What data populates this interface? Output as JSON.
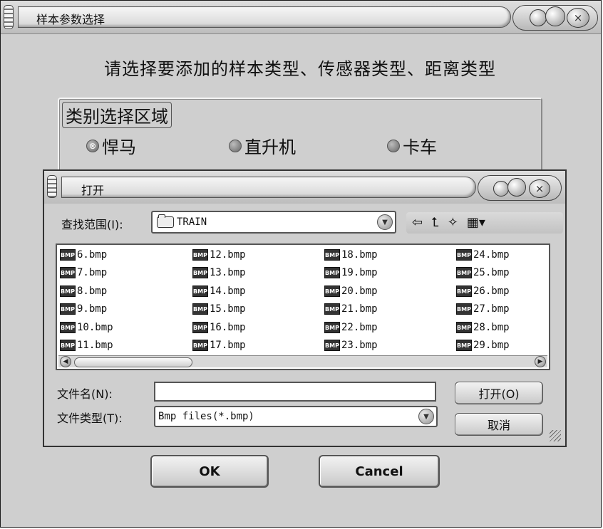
{
  "main_window": {
    "title": "样本参数选择",
    "prompt": "请选择要添加的样本类型、传感器类型、距离类型",
    "group_title": "类别选择区域",
    "radios": [
      {
        "label": "悍马",
        "selected": true
      },
      {
        "label": "直升机",
        "selected": false
      },
      {
        "label": "卡车",
        "selected": false
      }
    ],
    "ok_label": "OK",
    "cancel_label": "Cancel",
    "close_glyph": "×"
  },
  "open_dialog": {
    "title": "打开",
    "look_in_label": "查找范围(I):",
    "look_in_value": "TRAIN",
    "toolbar_icons": [
      "back-arrow-icon",
      "up-folder-icon",
      "new-folder-icon",
      "view-menu-icon"
    ],
    "toolbar_glyphs": {
      "back": "⇦",
      "up": "⮤",
      "new_folder": "✧",
      "view": "▦▾"
    },
    "icon_label": "BMP",
    "files": [
      [
        "6.bmp",
        "7.bmp",
        "8.bmp",
        "9.bmp",
        "10.bmp",
        "11.bmp"
      ],
      [
        "12.bmp",
        "13.bmp",
        "14.bmp",
        "15.bmp",
        "16.bmp",
        "17.bmp"
      ],
      [
        "18.bmp",
        "19.bmp",
        "20.bmp",
        "21.bmp",
        "22.bmp",
        "23.bmp"
      ],
      [
        "24.bmp",
        "25.bmp",
        "26.bmp",
        "27.bmp",
        "28.bmp",
        "29.bmp"
      ]
    ],
    "filename_label": "文件名(N):",
    "filename_value": "",
    "filetype_label": "文件类型(T):",
    "filetype_value": "Bmp files(*.bmp)",
    "open_button": "打开(O)",
    "cancel_button": "取消"
  }
}
